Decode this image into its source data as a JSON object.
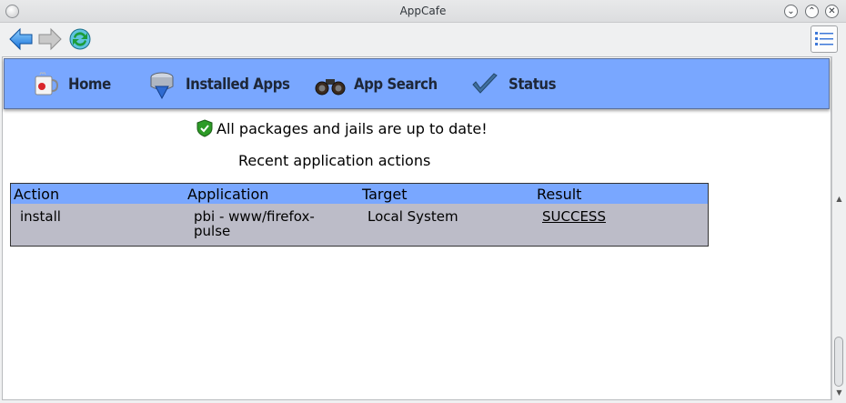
{
  "window": {
    "title": "AppCafe"
  },
  "toolbar": {
    "back_icon": "back-arrow-icon",
    "forward_icon": "forward-arrow-icon",
    "refresh_icon": "refresh-icon",
    "menu_icon": "hamburger-menu-icon"
  },
  "nav": {
    "items": [
      {
        "label": "Home",
        "icon": "coffee-mug-icon"
      },
      {
        "label": "Installed Apps",
        "icon": "hard-drive-icon"
      },
      {
        "label": "App Search",
        "icon": "binoculars-icon"
      },
      {
        "label": "Status",
        "icon": "checkmark-icon"
      }
    ]
  },
  "main": {
    "status_message": "All packages and jails are up to date!",
    "status_icon": "shield-check-icon",
    "recent_title": "Recent application actions",
    "table": {
      "headers": [
        "Action",
        "Application",
        "Target",
        "Result"
      ],
      "rows": [
        {
          "action": "install",
          "application": "pbi - www/firefox-pulse",
          "target": "Local System",
          "result": "SUCCESS"
        }
      ]
    }
  },
  "colors": {
    "nav_bg": "#79a7ff",
    "table_body_bg": "#bcbcc8",
    "shield_green": "#2d9b27"
  }
}
